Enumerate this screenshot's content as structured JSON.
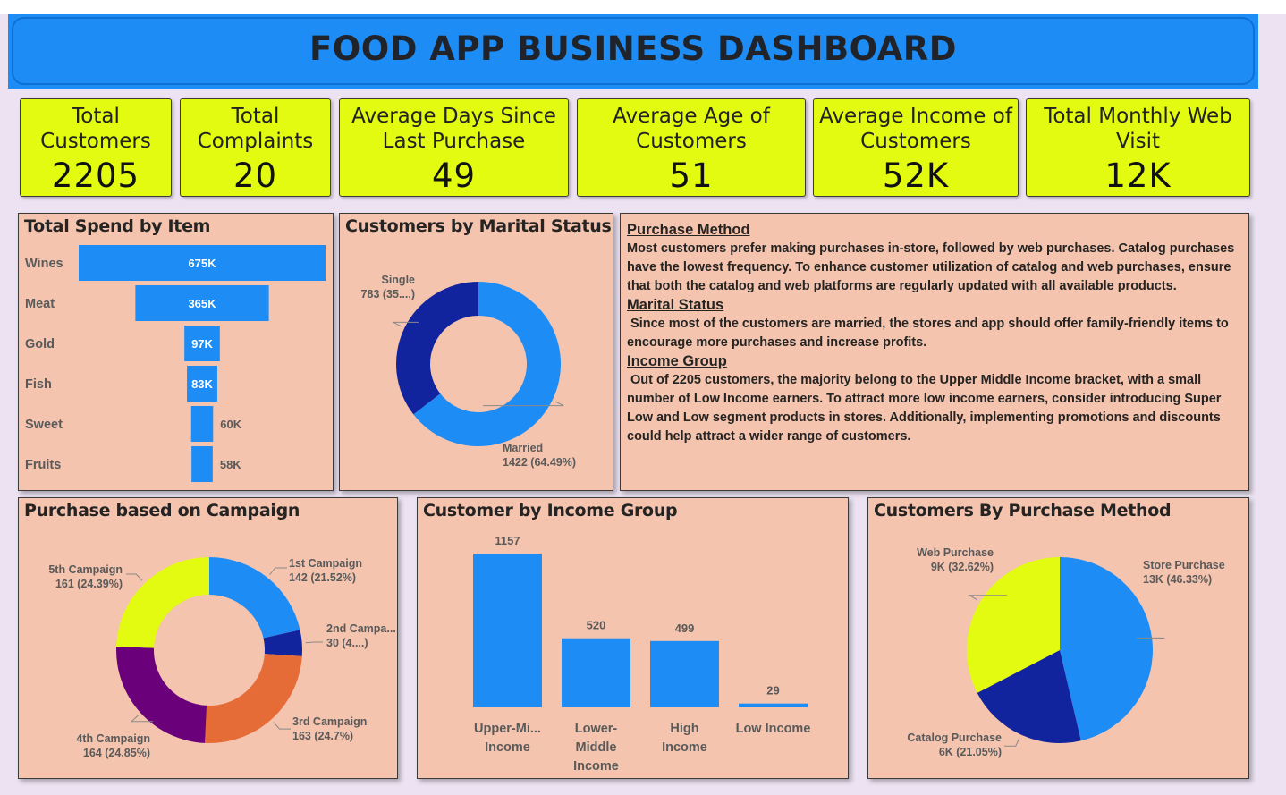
{
  "title": "FOOD APP BUSINESS DASHBOARD",
  "kpis": [
    {
      "label": "Total Customers",
      "value": "2205"
    },
    {
      "label": "Total Complaints",
      "value": "20"
    },
    {
      "label": "Average Days Since Last Purchase",
      "value": "49"
    },
    {
      "label": "Average Age of Customers",
      "value": "51"
    },
    {
      "label": "Average Income of Customers",
      "value": "52K"
    },
    {
      "label": "Total Monthly Web Visit",
      "value": "12K"
    }
  ],
  "notes": {
    "purchase_method_heading": "Purchase Method",
    "purchase_method_text": "Most customers prefer making purchases in-store, followed by web purchases. Catalog purchases have the lowest frequency. To enhance customer utilization of catalog and web purchases, ensure that both the catalog and web platforms are regularly updated with all available products.",
    "marital_status_heading": "Marital Status",
    "marital_status_text": " Since most of the customers are married, the stores and app should offer family-friendly items to encourage more purchases and increase profits.",
    "income_group_heading": "Income Group",
    "income_group_text": " Out of 2205 customers, the majority belong to the Upper Middle Income bracket, with a small number of Low Income earners. To attract more low income earners, consider introducing Super Low and Low segment products in stores. Additionally, implementing promotions and discounts could help attract a wider range of customers."
  },
  "colors": {
    "blue": "#1e8cf5",
    "navy": "#12239e",
    "lime": "#e2fb10",
    "orange": "#e66c37",
    "purple": "#6b007b",
    "panel": "#f4c4ae"
  },
  "chart_data": [
    {
      "id": "spend",
      "type": "bar",
      "orientation": "horizontal-funnel",
      "title": "Total Spend by Item",
      "categories": [
        "Wines",
        "Meat",
        "Gold",
        "Fish",
        "Sweet",
        "Fruits"
      ],
      "values": [
        675,
        365,
        97,
        83,
        60,
        58
      ],
      "labels": [
        "675K",
        "365K",
        "97K",
        "83K",
        "60K",
        "58K"
      ],
      "unit": "K"
    },
    {
      "id": "marital",
      "type": "pie",
      "donut": true,
      "title": "Customers by Marital Status",
      "slices": [
        {
          "name": "Married",
          "value": 1422,
          "label_line1": "Married",
          "label_line2": "1422 (64.49%)",
          "color": "#1e8cf5"
        },
        {
          "name": "Single",
          "value": 783,
          "label_line1": "Single",
          "label_line2": "783 (35....)",
          "color": "#12239e"
        }
      ]
    },
    {
      "id": "campaign",
      "type": "pie",
      "donut": true,
      "title": "Purchase based on Campaign",
      "slices": [
        {
          "name": "1st Campaign",
          "value": 142,
          "label_line1": "1st Campaign",
          "label_line2": "142 (21.52%)",
          "color": "#1e8cf5"
        },
        {
          "name": "2nd Campaign",
          "value": 30,
          "label_line1": "2nd Campa...",
          "label_line2": "30 (4....)",
          "color": "#12239e"
        },
        {
          "name": "3rd Campaign",
          "value": 163,
          "label_line1": "3rd Campaign",
          "label_line2": "163 (24.7%)",
          "color": "#e66c37"
        },
        {
          "name": "4th Campaign",
          "value": 164,
          "label_line1": "4th Campaign",
          "label_line2": "164 (24.85%)",
          "color": "#6b007b"
        },
        {
          "name": "5th Campaign",
          "value": 161,
          "label_line1": "5th Campaign",
          "label_line2": "161 (24.39%)",
          "color": "#e2fb10"
        }
      ]
    },
    {
      "id": "income",
      "type": "bar",
      "title": "Customer by Income Group",
      "categories": [
        "Upper-Mi... Income",
        "Lower-Middle Income",
        "High Income",
        "Low Income"
      ],
      "category_lines": [
        [
          "Upper-Mi...",
          "Income"
        ],
        [
          "Lower-",
          "Middle",
          "Income"
        ],
        [
          "High",
          "Income"
        ],
        [
          "Low Income"
        ]
      ],
      "values": [
        1157,
        520,
        499,
        29
      ]
    },
    {
      "id": "method",
      "type": "pie",
      "donut": false,
      "title": "Customers By Purchase Method",
      "slices": [
        {
          "name": "Store Purchase",
          "value": 46.33,
          "label_line1": "Store Purchase",
          "label_line2": "13K (46.33%)",
          "color": "#1e8cf5"
        },
        {
          "name": "Catalog Purchase",
          "value": 21.05,
          "label_line1": "Catalog Purchase",
          "label_line2": "6K (21.05%)",
          "color": "#12239e"
        },
        {
          "name": "Web Purchase",
          "value": 32.62,
          "label_line1": "Web Purchase",
          "label_line2": "9K (32.62%)",
          "color": "#e2fb10"
        }
      ]
    }
  ]
}
